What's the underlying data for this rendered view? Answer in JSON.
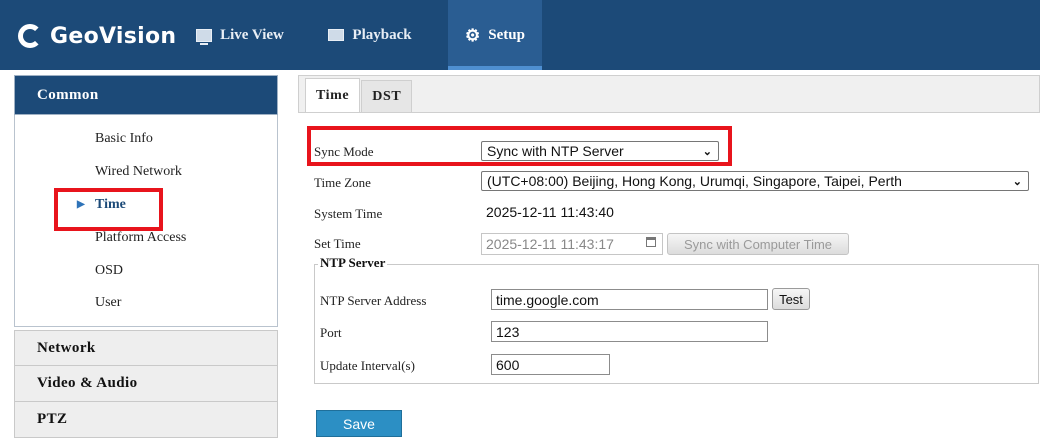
{
  "header": {
    "brand": "GeoVision",
    "nav": [
      {
        "label": "Live View",
        "icon": "monitor-icon"
      },
      {
        "label": "Playback",
        "icon": "film-icon"
      },
      {
        "label": "Setup",
        "icon": "gear-icon"
      }
    ],
    "active_nav": "Setup"
  },
  "sidebar": {
    "section": "Common",
    "items": [
      {
        "label": "Basic Info"
      },
      {
        "label": "Wired Network"
      },
      {
        "label": "Time"
      },
      {
        "label": "Platform Access"
      },
      {
        "label": "OSD"
      },
      {
        "label": "User"
      }
    ],
    "active_item": "Time",
    "categories": [
      "Network",
      "Video & Audio",
      "PTZ"
    ]
  },
  "tabs": [
    {
      "label": "Time"
    },
    {
      "label": "DST"
    }
  ],
  "active_tab": "Time",
  "form": {
    "sync_mode": {
      "label": "Sync Mode",
      "value": "Sync with NTP Server"
    },
    "time_zone": {
      "label": "Time Zone",
      "value": "(UTC+08:00) Beijing, Hong Kong, Urumqi, Singapore, Taipei, Perth"
    },
    "system_time": {
      "label": "System Time",
      "value": "2025-12-11 11:43:40"
    },
    "set_time": {
      "label": "Set Time",
      "value": "2025-12-11 11:43:17",
      "sync_button": "Sync with Computer Time"
    },
    "ntp": {
      "legend": "NTP Server",
      "address": {
        "label": "NTP Server Address",
        "value": "time.google.com",
        "test_button": "Test"
      },
      "port": {
        "label": "Port",
        "value": "123"
      },
      "update_interval": {
        "label": "Update Interval(s)",
        "value": "600"
      }
    },
    "save_button": "Save"
  },
  "colors": {
    "brand_bar": "#1c4a78",
    "highlight": "#e8141c",
    "save_button": "#2c8fc4"
  }
}
